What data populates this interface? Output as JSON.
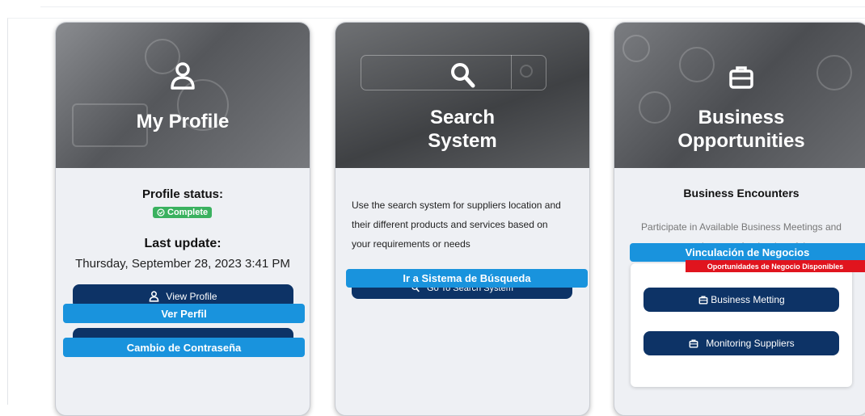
{
  "profile_card": {
    "title": "My Profile",
    "status_label": "Profile status:",
    "status_badge": "Complete",
    "last_update_label": "Last update:",
    "last_update_value": "Thursday, September 28, 2023 3:41 PM",
    "view_profile_label": "View Profile",
    "ver_perfil_label": "Ver Perfil",
    "change_password_label": "Cambio de Contraseña"
  },
  "search_card": {
    "title_line1": "Search",
    "title_line2": "System",
    "description_lines": [
      "Use the search system for suppliers location and",
      "their different products and services based on",
      "your requirements or needs"
    ],
    "go_button_label": "Go To Search System",
    "ir_button_label": "Ir a Sistema de Búsqueda"
  },
  "business_card": {
    "title_line1": "Business",
    "title_line2": "Opportunities",
    "section_heading": "Business Encounters",
    "description_lines": [
      "Participate in Available Business Meetings and",
      "manage appointments for the day of the event"
    ],
    "vinculacion_label": "Vinculación de Negocios",
    "oportunidades_label": "Oportunidades de Negocio Disponibles",
    "business_metting_label": "Business Metting",
    "monitoring_suppliers_label": "Monitoring Suppliers"
  },
  "colors": {
    "navy": "#0d3366",
    "overlay_blue": "#1993dd",
    "badge_green": "#3ab15f",
    "tag_red": "#e0141e"
  },
  "icons": [
    "user-icon",
    "search-icon",
    "briefcase-icon",
    "check-circle-icon"
  ]
}
